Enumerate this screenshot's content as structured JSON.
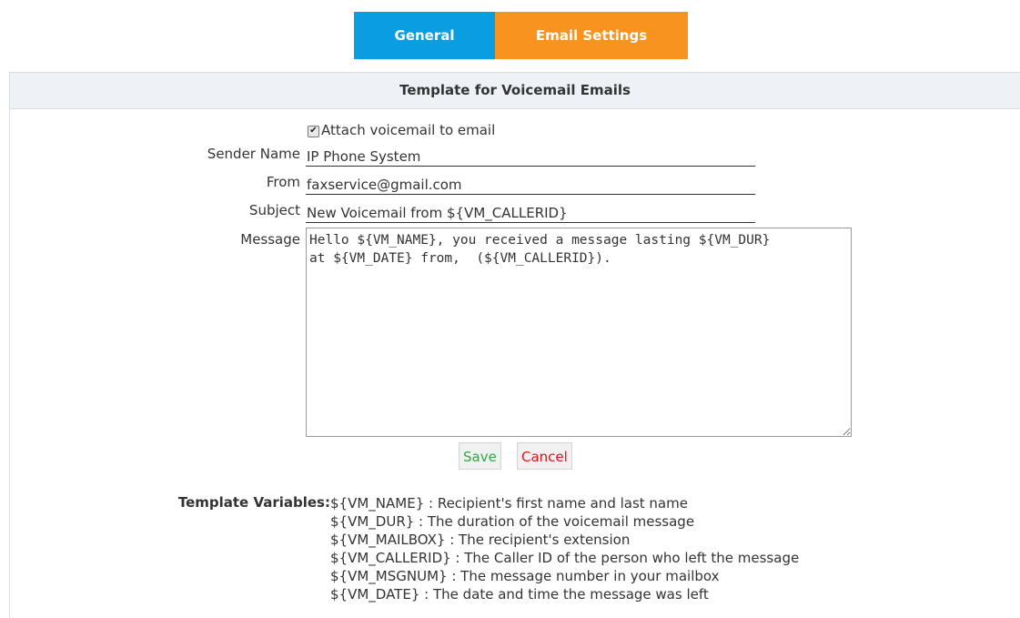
{
  "tabs": {
    "general_label": "General",
    "email_label": "Email Settings"
  },
  "panel": {
    "title": "Template for Voicemail Emails"
  },
  "form": {
    "attach_label": "Attach voicemail to email",
    "attach_checked": true,
    "sender_name_label": "Sender Name",
    "sender_name_value": "IP Phone System",
    "from_label": "From",
    "from_value": "faxservice@gmail.com",
    "subject_label": "Subject",
    "subject_value": "New Voicemail from ${VM_CALLERID}",
    "message_label": "Message",
    "message_value": "Hello ${VM_NAME}, you received a message lasting ${VM_DUR}\nat ${VM_DATE} from,  (${VM_CALLERID})."
  },
  "buttons": {
    "save_label": "Save",
    "cancel_label": "Cancel"
  },
  "template_variables": {
    "label": "Template Variables:",
    "items": [
      "${VM_NAME} : Recipient's first name and last name",
      "${VM_DUR} : The duration of the voicemail message",
      "${VM_MAILBOX} : The recipient's extension",
      "${VM_CALLERID} : The Caller ID of the person who left the message",
      "${VM_MSGNUM} : The message number in your mailbox",
      "${VM_DATE} : The date and time the message was left"
    ]
  },
  "colors": {
    "tab_general": "#0a9ee0",
    "tab_email": "#f7931e",
    "save_text": "#2ea845",
    "cancel_text": "#e3131b",
    "header_bg": "#eef2f7"
  }
}
